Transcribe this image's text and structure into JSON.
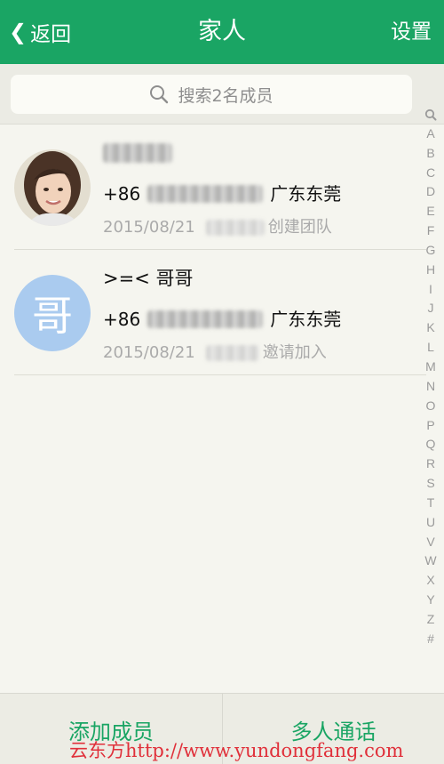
{
  "navbar": {
    "back_label": "返回",
    "title": "家人",
    "settings_label": "设置",
    "color": "#1aa564"
  },
  "search": {
    "placeholder": "搜索2名成员"
  },
  "members": [
    {
      "avatar": "photo",
      "name": "",
      "phone_prefix": "+86",
      "location": "广东东莞",
      "date": "2015/08/21",
      "action": "创建团队"
    },
    {
      "avatar": "letter",
      "avatar_letter": "哥",
      "name": ">=< 哥哥",
      "phone_prefix": "+86",
      "location": "广东东莞",
      "date": "2015/08/21",
      "action": "邀请加入"
    }
  ],
  "index_letters": [
    "A",
    "B",
    "C",
    "D",
    "E",
    "F",
    "G",
    "H",
    "I",
    "J",
    "K",
    "L",
    "M",
    "N",
    "O",
    "P",
    "Q",
    "R",
    "S",
    "T",
    "U",
    "V",
    "W",
    "X",
    "Y",
    "Z",
    "#"
  ],
  "bottom": {
    "add_member": "添加成员",
    "group_call": "多人通话"
  },
  "watermark": "云东方http://www.yundongfang.com"
}
